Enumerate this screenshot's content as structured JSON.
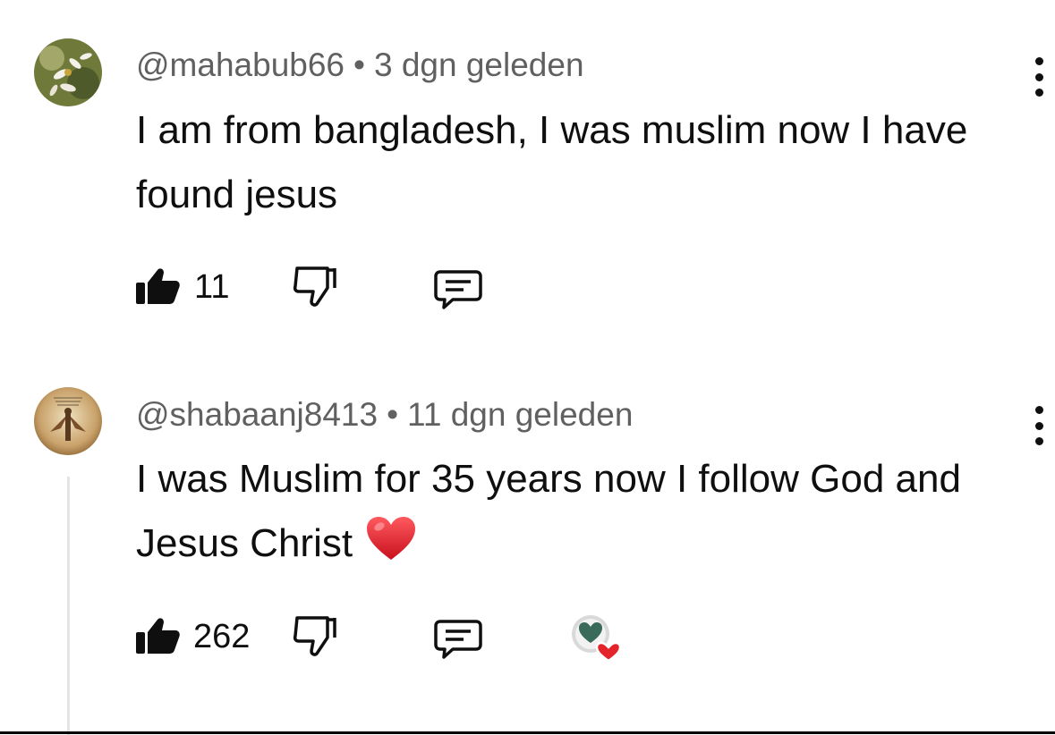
{
  "comments": [
    {
      "author": "@mahabub66",
      "separator": "•",
      "time": "3 dgn geleden",
      "text": "I am from bangladesh, I was muslim now I have found jesus",
      "like_count": "11",
      "avatar_icon": "flower-photo-avatar",
      "like_state": "liked"
    },
    {
      "author": "@shabaanj8413",
      "separator": "•",
      "time": "11 dgn geleden",
      "text": "I was Muslim for 35 years now I follow God and Jesus Christ",
      "emoji_icon": "red-heart-emoji",
      "like_count": "262",
      "avatar_icon": "angel-painting-avatar",
      "like_state": "liked",
      "creator_heart": true
    }
  ],
  "colors": {
    "meta_text": "#606060",
    "primary_text": "#0f0f0f",
    "heart_red": "#e3242b",
    "thread_line": "#e5e5e5"
  }
}
